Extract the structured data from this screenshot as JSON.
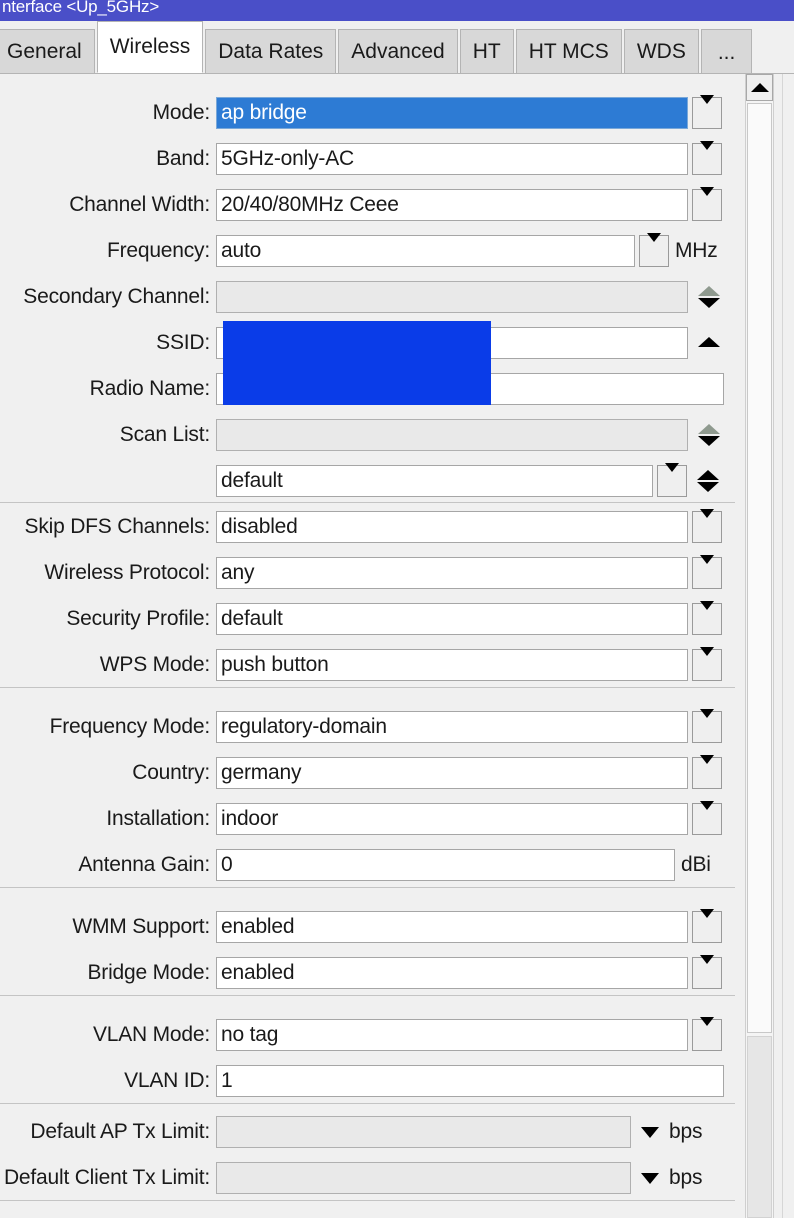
{
  "window": {
    "title": "nterface <Up_5GHz>"
  },
  "tabs": [
    {
      "label": "General",
      "active": false
    },
    {
      "label": "Wireless",
      "active": true
    },
    {
      "label": "Data Rates",
      "active": false
    },
    {
      "label": "Advanced",
      "active": false
    },
    {
      "label": "HT",
      "active": false
    },
    {
      "label": "HT MCS",
      "active": false
    },
    {
      "label": "WDS",
      "active": false
    },
    {
      "label": "...",
      "active": false
    }
  ],
  "form": {
    "mode": {
      "label": "Mode:",
      "value": "ap bridge"
    },
    "band": {
      "label": "Band:",
      "value": "5GHz-only-AC"
    },
    "channel_width": {
      "label": "Channel Width:",
      "value": "20/40/80MHz Ceee"
    },
    "frequency": {
      "label": "Frequency:",
      "value": "auto",
      "unit": "MHz"
    },
    "secondary_channel": {
      "label": "Secondary Channel:",
      "value": ""
    },
    "ssid": {
      "label": "SSID:",
      "value": ""
    },
    "radio_name": {
      "label": "Radio Name:",
      "value": ""
    },
    "scan_list": {
      "label": "Scan List:",
      "value": ""
    },
    "scan_list_profile": {
      "label": "",
      "value": "default"
    },
    "skip_dfs_channels": {
      "label": "Skip DFS Channels:",
      "value": "disabled"
    },
    "wireless_protocol": {
      "label": "Wireless Protocol:",
      "value": "any"
    },
    "security_profile": {
      "label": "Security Profile:",
      "value": "default"
    },
    "wps_mode": {
      "label": "WPS Mode:",
      "value": "push button"
    },
    "frequency_mode": {
      "label": "Frequency Mode:",
      "value": "regulatory-domain"
    },
    "country": {
      "label": "Country:",
      "value": "germany"
    },
    "installation": {
      "label": "Installation:",
      "value": "indoor"
    },
    "antenna_gain": {
      "label": "Antenna Gain:",
      "value": "0",
      "unit": "dBi"
    },
    "wmm_support": {
      "label": "WMM Support:",
      "value": "enabled"
    },
    "bridge_mode": {
      "label": "Bridge Mode:",
      "value": "enabled"
    },
    "vlan_mode": {
      "label": "VLAN Mode:",
      "value": "no tag"
    },
    "vlan_id": {
      "label": "VLAN ID:",
      "value": "1"
    },
    "default_ap_tx_limit": {
      "label": "Default AP Tx Limit:",
      "value": "",
      "unit": "bps"
    },
    "default_client_tx_limit": {
      "label": "Default Client Tx Limit:",
      "value": "",
      "unit": "bps"
    }
  },
  "colors": {
    "titlebar": "#4a4fc8",
    "selection": "#2d7bd4",
    "redaction": "#0a3ce8",
    "panel": "#f0f0f0"
  }
}
